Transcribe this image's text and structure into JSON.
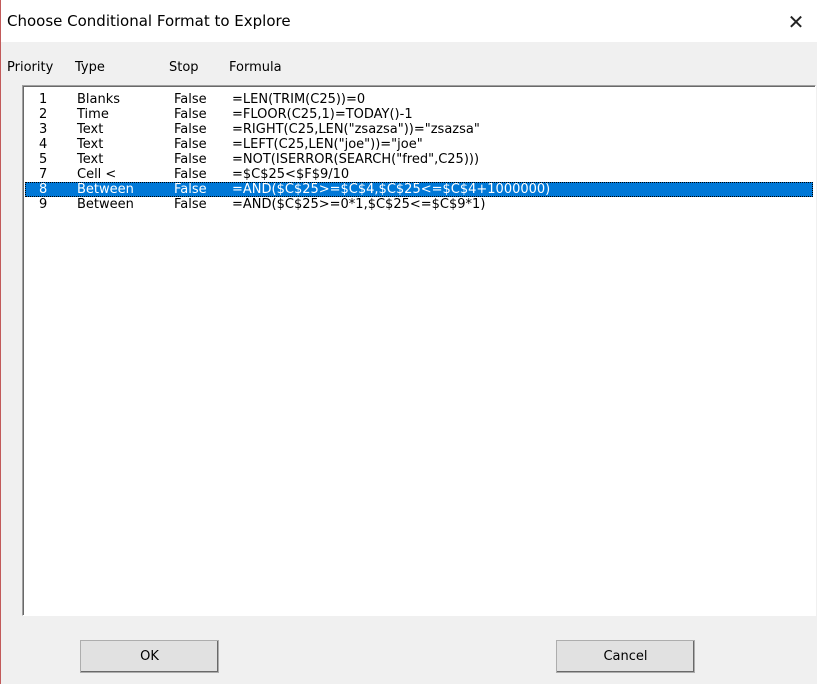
{
  "window": {
    "title": "Choose Conditional Format to Explore",
    "close_glyph": "✕"
  },
  "columns": {
    "priority": "Priority",
    "type": "Type",
    "stop": "Stop",
    "formula": "Formula"
  },
  "rows": [
    {
      "priority": "1",
      "type": "Blanks",
      "stop": "False",
      "formula": "=LEN(TRIM(C25))=0",
      "selected": false
    },
    {
      "priority": "2",
      "type": "Time",
      "stop": "False",
      "formula": "=FLOOR(C25,1)=TODAY()-1",
      "selected": false
    },
    {
      "priority": "3",
      "type": "Text",
      "stop": "False",
      "formula": "=RIGHT(C25,LEN(\"zsazsa\"))=\"zsazsa\"",
      "selected": false
    },
    {
      "priority": "4",
      "type": "Text",
      "stop": "False",
      "formula": "=LEFT(C25,LEN(\"joe\"))=\"joe\"",
      "selected": false
    },
    {
      "priority": "5",
      "type": "Text",
      "stop": "False",
      "formula": "=NOT(ISERROR(SEARCH(\"fred\",C25)))",
      "selected": false
    },
    {
      "priority": "7",
      "type": "Cell <",
      "stop": "False",
      "formula": "=$C$25<$F$9/10",
      "selected": false
    },
    {
      "priority": "8",
      "type": "Between",
      "stop": "False",
      "formula": "=AND($C$25>=$C$4,$C$25<=$C$4+1000000)",
      "selected": true
    },
    {
      "priority": "9",
      "type": "Between",
      "stop": "False",
      "formula": "=AND($C$25>=0*1,$C$25<=$C$9*1)",
      "selected": false
    }
  ],
  "buttons": {
    "ok": "OK",
    "cancel": "Cancel"
  },
  "colors": {
    "selection": "#0078d7",
    "dialog_bg": "#f0f0f0"
  }
}
